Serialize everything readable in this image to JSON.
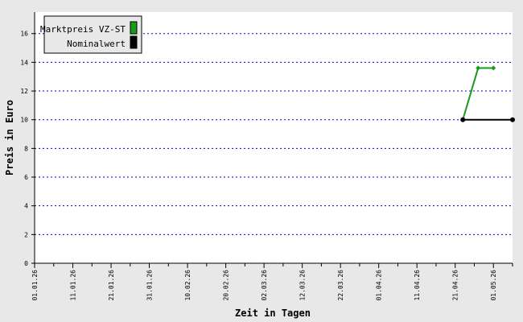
{
  "chart_data": {
    "type": "line",
    "xlabel": "Zeit in Tagen",
    "ylabel": "Preis in Euro",
    "ylim": [
      0,
      17.5
    ],
    "yticks": [
      0,
      2,
      4,
      6,
      8,
      10,
      12,
      14,
      16
    ],
    "x_range": [
      "2026-01-01",
      "2026-05-06"
    ],
    "x_tick_labels": [
      "01.01.26",
      "11.01.26",
      "21.01.26",
      "31.01.26",
      "10.02.26",
      "20.02.26",
      "02.03.26",
      "12.03.26",
      "22.03.26",
      "01.04.26",
      "11.04.26",
      "21.04.26",
      "01.05.26"
    ],
    "grid": true,
    "legend_position": "top-left",
    "colors": {
      "plot_bg": "#ffffff",
      "outer_bg": "#e8e8e8",
      "grid": "#0000cc",
      "legend_bg": "#e8e8e8"
    },
    "series": [
      {
        "name": "Marktpreis VZ-ST",
        "color": "#1a9a1a",
        "marker": "diamond",
        "points": [
          {
            "x": "2026-04-23",
            "y": 10.0
          },
          {
            "x": "2026-04-27",
            "y": 13.6
          },
          {
            "x": "2026-05-01",
            "y": 13.6
          }
        ]
      },
      {
        "name": "Nominalwert",
        "color": "#000000",
        "marker": "circle",
        "points": [
          {
            "x": "2026-04-23",
            "y": 10.0
          },
          {
            "x": "2026-05-06",
            "y": 10.0
          }
        ]
      }
    ]
  }
}
